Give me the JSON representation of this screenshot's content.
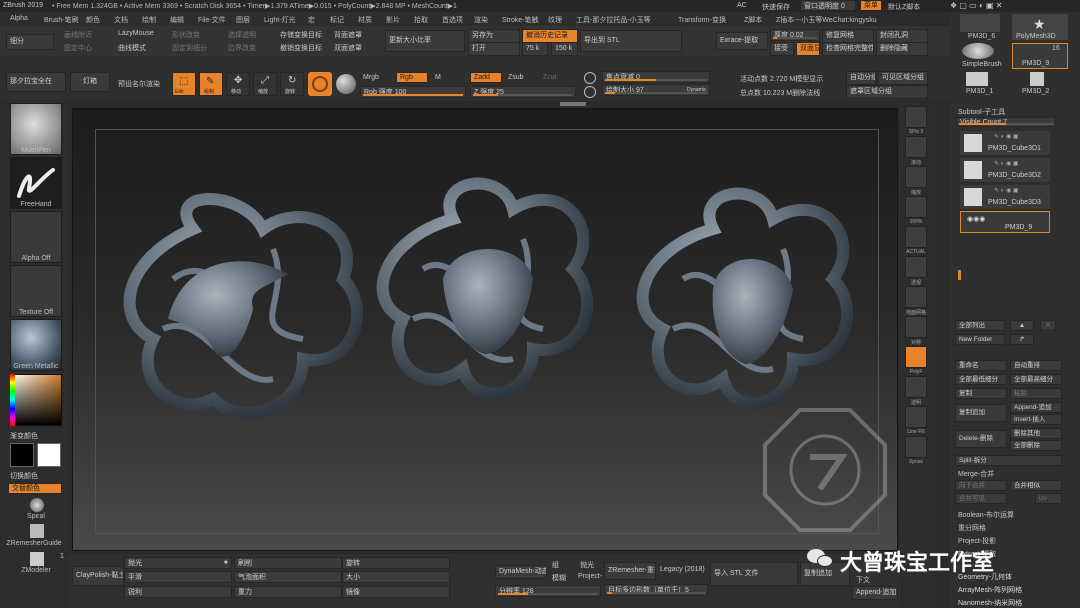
{
  "titlebar": {
    "app": "ZBrush 2019",
    "stats": "• Free Mem 1.324GB • Active Mem 3369 • Scratch Disk 3654 • Timer▶1.379 ATime▶0.015 • PolyCount▶2.848 MP • MeshCount▶1",
    "ac": "AC",
    "quicksave": "快速保存",
    "transparency": "窗口透明度 0",
    "menu_btn": "菜单",
    "default_script": "默认Z脚本"
  },
  "menubar": [
    "Alpha",
    "Brush-笔刷",
    "颜色",
    "文档",
    "绘制",
    "编辑",
    "File-文件",
    "图层",
    "Light-灯光",
    "宏",
    "标记",
    "材质",
    "影片",
    "拾取",
    "首选项",
    "渲染",
    "Stroke-笔触",
    "纹理",
    "工具-那夕拉托品-小玉等",
    "Transform-变换",
    "Z脚本",
    "Z插本---小玉等WeChat:kingysku"
  ],
  "toolbar1": {
    "subdiv": "细分",
    "lazymouse": "LazyMouse",
    "curve_mode": "曲线模式",
    "dim1": "画线附近",
    "dim2": "固定中心",
    "dim3": "固定到细分",
    "dim4": "形状改变",
    "dim5": "选择透明",
    "dim6": "边界改变",
    "s1": "存储变换目标",
    "s2": "撤销变换目标",
    "s3": "背面遮罩",
    "s4": "双面遮罩",
    "resize": "更新大小比率",
    "saveas": "另存为",
    "open": "打开",
    "history": "撤消历史记录",
    "v75": "75 k",
    "v150": "150 k",
    "export_stl": "导出到 STL",
    "extract": "Exrace-提取",
    "thickness": "厚度 0.02",
    "fix_mesh": "修复网格",
    "closed_holes": "封闭孔洞",
    "accept": "接受",
    "double": "双面显",
    "check_mesh": "检查网格完整性",
    "delete_hidden": "删除隐藏"
  },
  "toolbar2": {
    "clear": "那夕拉宝全在",
    "light": "灯箱",
    "bpr": "预设名尔渲染",
    "edit": "Edit",
    "draw": "绘制",
    "move": "移动",
    "scale": "缩放",
    "rotate": "旋转",
    "mrgb": "Mrgb",
    "rgb": "Rgb",
    "m": "M",
    "rgb_intensity": "Rgb 强度 100",
    "zadd": "Zadd",
    "zsub": "Zsub",
    "zcut": "Zcut",
    "z_intensity": "Z 强度 25",
    "focal_shift": "焦点衰减 0",
    "draw_size": "绘制大小 97",
    "dynamic": "Dynamic",
    "active_points": "活动点数 2.720 M模型显示",
    "total_points": "总点数 10.223 M删除法线",
    "auto_group": "自动分组",
    "visible_groups": "可见区域分组",
    "mask_groups": "遮罩区域分组"
  },
  "leftpanel": {
    "brush": "MoeliPen",
    "stroke": "FreeHand",
    "alpha": "Alpha Off",
    "texture": "Texture Off",
    "material": "Green Metallic",
    "gradient": "渐变颜色",
    "switch_color": "切换颜色",
    "alternate": "交替颜色",
    "spiral": "Spiral",
    "zremesher": "ZRemesherGuide",
    "zmodeler": "ZModeler",
    "count": "1"
  },
  "righttools": [
    "SPix 3",
    "滚动",
    "缩放",
    "100%",
    "ACTUAL",
    "透视",
    "地面网格",
    "对称",
    "PolyF",
    "透明",
    "Line Fill",
    "Xpose"
  ],
  "toppreview": {
    "pm3d6": "PM3D_6",
    "polymesh": "PolyMesh3D",
    "simplebrush": "SimpleBrush",
    "pm3d9": "PM3D_9",
    "pm3d1": "PM3D_1",
    "pm3d2": "PM3D_2",
    "count16": "16"
  },
  "subtool": {
    "header": "Subtool-子工具",
    "visible_count": "Visible Count 7",
    "items": [
      "PM3D_Cube3D1",
      "PM3D_Cube3D2",
      "PM3D_Cube3D3"
    ],
    "selected": "PM3D_9",
    "list_all": "全部列出",
    "new_folder": "New Folder",
    "rename": "重命名",
    "auto_reorder": "自动重排",
    "all_low": "全部最低细分",
    "all_high": "全部最高细分",
    "copy": "复制",
    "paste": "粘贴",
    "dup_add": "复制追加",
    "append": "Append-追加",
    "insert": "Insert-插入",
    "delete": "Delete-删除",
    "delete_other": "删除其他",
    "delete_all": "全部删除",
    "split": "Split-拆分",
    "merge": "Merge-合并",
    "merge_down": "向下合并",
    "merge_similar": "合并相似",
    "merge_visible": "合并可见",
    "uv": "Uv",
    "boolean": "Boolean-布尔运算",
    "remesh": "重分网格",
    "project": "Project-投影",
    "extract": "Extract-提取",
    "geometry": "Geometry-几何体",
    "arraymesh": "ArrayMesh-阵列网格",
    "nanomesh": "Nanomesh-纳米网格"
  },
  "bottombar": {
    "claypolish": "ClayPolish-黏土",
    "polish": "抛光",
    "smooth": "平滑",
    "sharpen": "锐利",
    "flatten": "刷削",
    "edge_smooth": "气泡面积",
    "strength": "重力",
    "rotate": "旋转",
    "size": "大小",
    "mirror": "镜像",
    "dynamesh": "DynaMesh-动态",
    "group": "组",
    "project": "Project-",
    "polish2": "抛光",
    "blur": "模糊",
    "resolution": "分辨率 128",
    "zremesher": "ZRemesher-重拓",
    "legacy": "Legacy (2018)",
    "target_poly": "目标多边形数（单位千）5",
    "import_stl": "导入 STL 文件",
    "morph": "复制追加",
    "extra": "下文",
    "append2": "Append-追加"
  },
  "watermark": {
    "text": "大曾珠宝工作室"
  }
}
